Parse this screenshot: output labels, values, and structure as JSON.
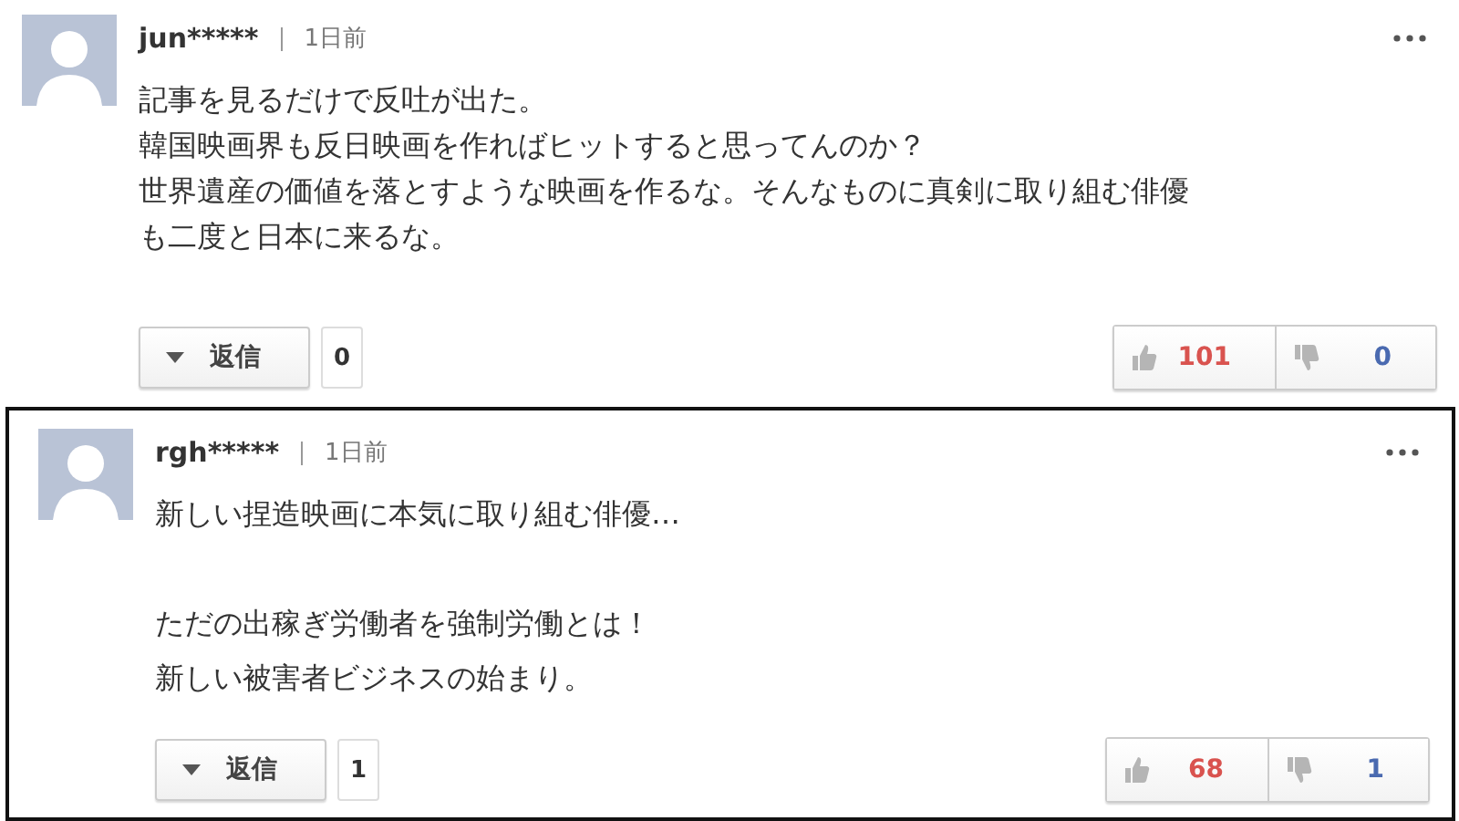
{
  "comments": [
    {
      "user": "jun*****",
      "time": "1日前",
      "paragraphs": [
        [
          "記事を見るだけで反吐が出た。",
          "韓国映画界も反日映画を作ればヒットすると思ってんのか？",
          "世界遺産の価値を落とすような映画を作るな。そんなものに真剣に取り組む俳優",
          "も二度と日本に来るな。"
        ]
      ],
      "reply_label": "返信",
      "reply_count": "0",
      "likes": "101",
      "dislikes": "0",
      "framed": false
    },
    {
      "user": "rgh*****",
      "time": "1日前",
      "paragraphs": [
        [
          "新しい捏造映画に本気に取り組む俳優…"
        ],
        [
          "ただの出稼ぎ労働者を強制労働とは！",
          "新しい被害者ビジネスの始まり。"
        ]
      ],
      "reply_label": "返信",
      "reply_count": "1",
      "likes": "68",
      "dislikes": "1",
      "framed": true
    }
  ]
}
